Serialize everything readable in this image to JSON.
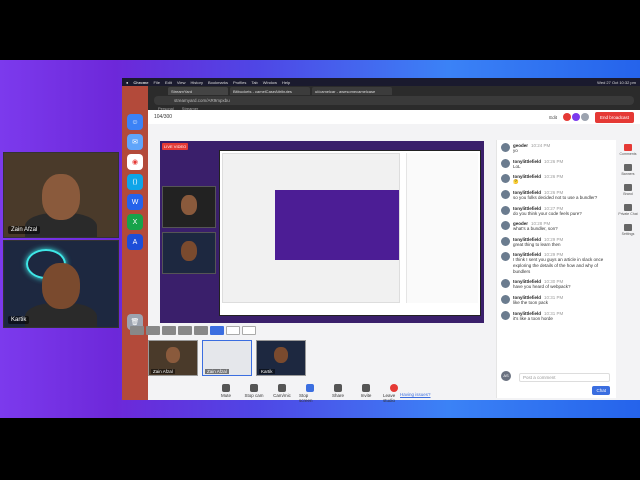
{
  "participants": {
    "zain": {
      "name": "Zain Afzal"
    },
    "kartik": {
      "name": "Kartik"
    },
    "zain_thumb": {
      "name": "Zain Afzal"
    },
    "screen_thumb": {
      "name": "Zain Afzal"
    },
    "kartik_thumb": {
      "name": "Kartik"
    }
  },
  "menubar": {
    "app": "Chrome",
    "items": [
      "File",
      "Edit",
      "View",
      "History",
      "Bookmarks",
      "Profiles",
      "Tab",
      "Window",
      "Help"
    ],
    "clock": "Wed 27 Oct  10:32 pm"
  },
  "browser": {
    "tabs": [
      "StreamYard",
      "Bitbuckets - camelCaseAttributes",
      "ui/camelcar - awesomecamelcase"
    ],
    "url": "streamyard.com/AR9mpxbu",
    "bookmarks": [
      "Personal",
      "Streamer"
    ]
  },
  "app": {
    "counter": "104/300",
    "edit_label": "Edit",
    "end_broadcast": "End broadcast",
    "live_badge": "LIVE VIDEO",
    "having_issues": "Having issues?",
    "brand_color": "#3b6ee0",
    "danger_color": "#e53935"
  },
  "controls": [
    {
      "label": "Mute",
      "icon": "microphone-icon"
    },
    {
      "label": "Stop cam",
      "icon": "camera-icon"
    },
    {
      "label": "Cam/mic",
      "icon": "gear-icon"
    },
    {
      "label": "Stop screen",
      "icon": "screen-share-icon"
    },
    {
      "label": "Share",
      "icon": "share-icon"
    },
    {
      "label": "Invite",
      "icon": "invite-icon"
    },
    {
      "label": "Leave studio",
      "icon": "leave-icon"
    }
  ],
  "chat": {
    "messages": [
      {
        "user": "geoder",
        "time": "10:24 PM",
        "text": "yo"
      },
      {
        "user": "tonylittlefield",
        "time": "10:26 PM",
        "text": "LoL"
      },
      {
        "user": "tonylittlefield",
        "time": "10:26 PM",
        "text": "🤔"
      },
      {
        "user": "tonylittlefield",
        "time": "10:26 PM",
        "text": "so you folks decided not to use a bundler?"
      },
      {
        "user": "tonylittlefield",
        "time": "10:27 PM",
        "text": "do you think your code feels pure?"
      },
      {
        "user": "geoder",
        "time": "10:28 PM",
        "text": "what's a bundler, son?"
      },
      {
        "user": "tonylittlefield",
        "time": "10:29 PM",
        "text": "great thing to learn then"
      },
      {
        "user": "tonylittlefield",
        "time": "10:29 PM",
        "text": "I think I sent you guys an article in slack once exploring the details of the how and why of bundlers"
      },
      {
        "user": "tonylittlefield",
        "time": "10:30 PM",
        "text": "have you heard of webpack?"
      },
      {
        "user": "tonylittlefield",
        "time": "10:31 PM",
        "text": "like the toon pack"
      },
      {
        "user": "tonylittlefield",
        "time": "10:31 PM",
        "text": "it's like a toon horde"
      }
    ],
    "input_placeholder": "Post a comment",
    "input_avatar": "AS",
    "send_label": "Chat"
  },
  "rail": [
    {
      "label": "Comments",
      "icon": "comments-icon"
    },
    {
      "label": "Banners",
      "icon": "banners-icon"
    },
    {
      "label": "Brand",
      "icon": "brand-icon"
    },
    {
      "label": "Private Chat",
      "icon": "private-chat-icon"
    },
    {
      "label": "Settings",
      "icon": "settings-icon"
    }
  ]
}
